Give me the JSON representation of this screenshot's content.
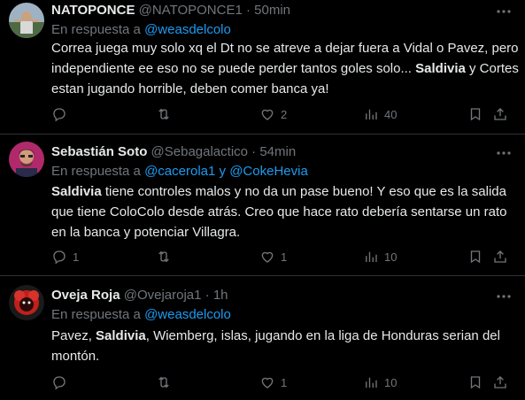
{
  "tweets": [
    {
      "name": "NATOPONCE",
      "handle": "@NATOPONCE1",
      "time": "· 50min",
      "reply_prefix": "En respuesta a",
      "reply_to": "@weasdelcolo",
      "reply_and": "",
      "reply_to2": "",
      "text": [
        {
          "t": "Correa juega muy solo xq el Dt no se atreve a dejar fuera a Vidal o Pavez, pero independiente ee eso no se puede perder tantos goles solo... ",
          "b": false
        },
        {
          "t": "Saldivia",
          "b": true
        },
        {
          "t": " y Cortes estan jugando horrible, deben comer banca ya!",
          "b": false
        }
      ],
      "replies": "",
      "retweets": "",
      "likes": "2",
      "views": "40"
    },
    {
      "name": "Sebastián Soto",
      "handle": "@Sebagalactico",
      "time": "· 54min",
      "reply_prefix": "En respuesta a",
      "reply_to": "@cacerola1",
      "reply_and": "y",
      "reply_to2": "@CokeHevia",
      "text": [
        {
          "t": "Saldivia",
          "b": true
        },
        {
          "t": " tiene controles malos y no da un pase bueno! Y eso que es la salida que tiene ColoColo desde atrás. Creo que hace rato debería sentarse un rato en la banca y potenciar Villagra.",
          "b": false
        }
      ],
      "replies": "1",
      "retweets": "",
      "likes": "1",
      "views": "10"
    },
    {
      "name": "Oveja Roja",
      "handle": "@Ovejaroja1",
      "time": "· 1h",
      "reply_prefix": "En respuesta a",
      "reply_to": "@weasdelcolo",
      "reply_and": "",
      "reply_to2": "",
      "text": [
        {
          "t": "Pavez, ",
          "b": false
        },
        {
          "t": "Saldivia",
          "b": true
        },
        {
          "t": ", Wiemberg, islas, jugando en la liga de Honduras serian del montón.",
          "b": false
        }
      ],
      "replies": "",
      "retweets": "",
      "likes": "1",
      "views": "10"
    }
  ],
  "icons": {
    "more": "more-icon",
    "reply": "reply-icon",
    "retweet": "retweet-icon",
    "like": "heart-icon",
    "views": "views-icon",
    "bookmark": "bookmark-icon",
    "share": "share-icon"
  },
  "colors": {
    "background": "#000000",
    "text": "#e7e9ea",
    "muted": "#71767b",
    "link": "#1d9bf0",
    "divider": "#2f3336"
  }
}
